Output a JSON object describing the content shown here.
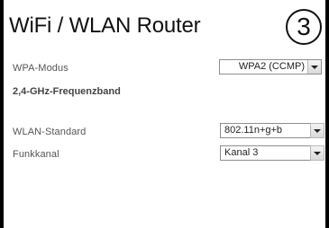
{
  "header": {
    "title": "WiFi / WLAN Router",
    "step": "3"
  },
  "form": {
    "wpa_mode": {
      "label": "WPA-Modus",
      "value": "WPA2 (CCMP)"
    },
    "section_title": "2,4-GHz-Frequenzband",
    "wlan_standard": {
      "label": "WLAN-Standard",
      "value": "802.11n+g+b"
    },
    "channel": {
      "label": "Funkkanal",
      "value": "Kanal 3"
    }
  }
}
